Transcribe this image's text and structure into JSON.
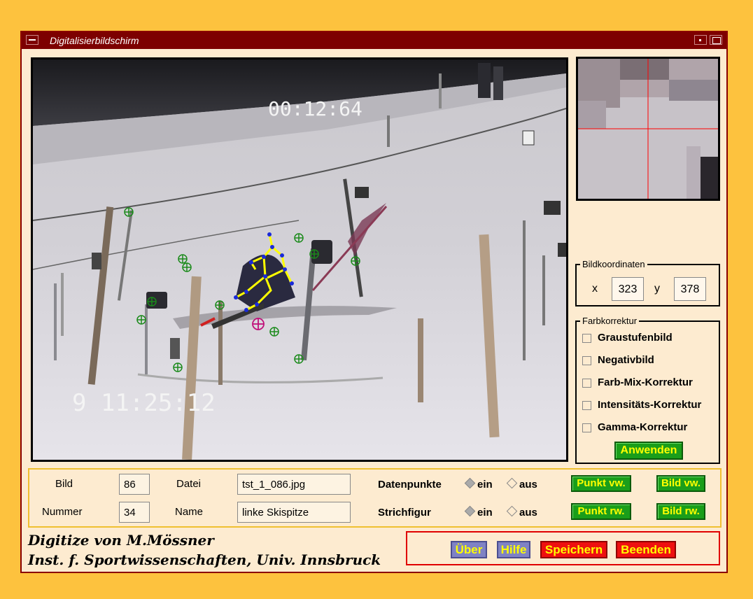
{
  "window": {
    "title": "Digitalisierbildschirm"
  },
  "video": {
    "timecode_top": "00:12:64",
    "timecode_bottom": "9 11:25:12"
  },
  "coords": {
    "legend": "Bildkoordinaten",
    "x_label": "x",
    "x_value": "323",
    "y_label": "y",
    "y_value": "378"
  },
  "farb": {
    "legend": "Farbkorrektur",
    "options": [
      "Graustufenbild",
      "Negativbild",
      "Farb-Mix-Korrektur",
      "Intensitäts-Korrektur",
      "Gamma-Korrektur"
    ],
    "apply_label": "Anwenden"
  },
  "info": {
    "bild_label": "Bild",
    "bild_value": "86",
    "nummer_label": "Nummer",
    "nummer_value": "34",
    "datei_label": "Datei",
    "datei_value": "tst_1_086.jpg",
    "name_label": "Name",
    "name_value": "linke Skispitze",
    "datenpunkte_label": "Datenpunkte",
    "strichfigur_label": "Strichfigur",
    "ein_label": "ein",
    "aus_label": "aus",
    "punkt_vw": "Punkt vw.",
    "bild_vw": "Bild vw.",
    "punkt_rw": "Punkt rw.",
    "bild_rw": "Bild rw."
  },
  "credits": {
    "line1": "Digitize von M.Mössner",
    "line2": "Inst. f. Sportwissenschaften, Univ. Innsbruck"
  },
  "buttons": {
    "ueber": "Über",
    "hilfe": "Hilfe",
    "speichern": "Speichern",
    "beenden": "Beenden"
  },
  "colors": {
    "titlebar": "#7d0000",
    "accent_green": "#1a9e1a",
    "accent_red": "#ee1010",
    "accent_blue": "#7f82c4",
    "stick_figure": "#ffff00"
  },
  "icons": {
    "marker": "crosshair-circle-icon"
  }
}
